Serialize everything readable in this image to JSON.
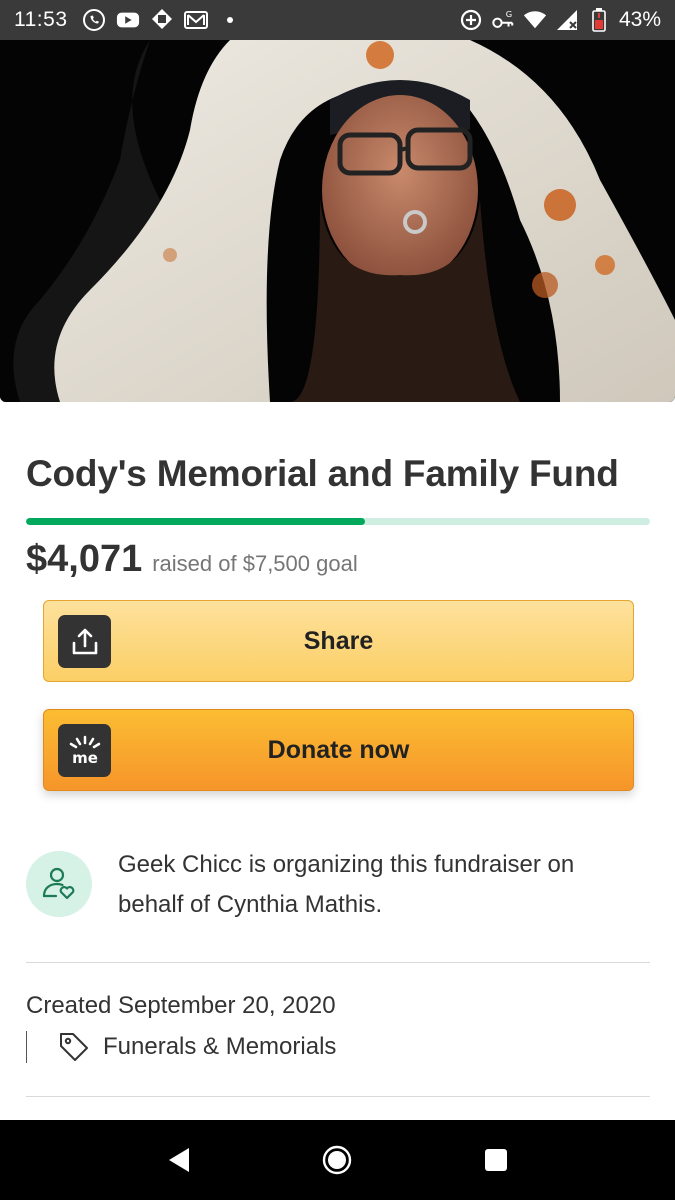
{
  "status_bar": {
    "time": "11:53",
    "battery": "43%",
    "left_icons": [
      "whatsapp-icon",
      "youtube-icon",
      "bank-icon",
      "gmail-icon",
      "dot-icon"
    ],
    "right_icons": [
      "data-saver-icon",
      "vpn-key-icon",
      "wifi-icon",
      "signal-icon",
      "battery-icon"
    ]
  },
  "campaign": {
    "title": "Cody's Memorial and Family Fund",
    "raised": "$4,071",
    "raised_of": "raised of $7,500 goal",
    "progress": 0.543
  },
  "buttons": {
    "share": "Share",
    "donate": "Donate now"
  },
  "organizer": {
    "text": "Geek Chicc is organizing this fundraiser on behalf of Cynthia Mathis."
  },
  "details": {
    "created": "Created September 20, 2020",
    "category": "Funerals & Memorials"
  },
  "colors": {
    "progress_fill": "#02a95c",
    "progress_track": "#cfeee2",
    "donate_button": "#f6952a",
    "share_button": "#fccf66"
  }
}
